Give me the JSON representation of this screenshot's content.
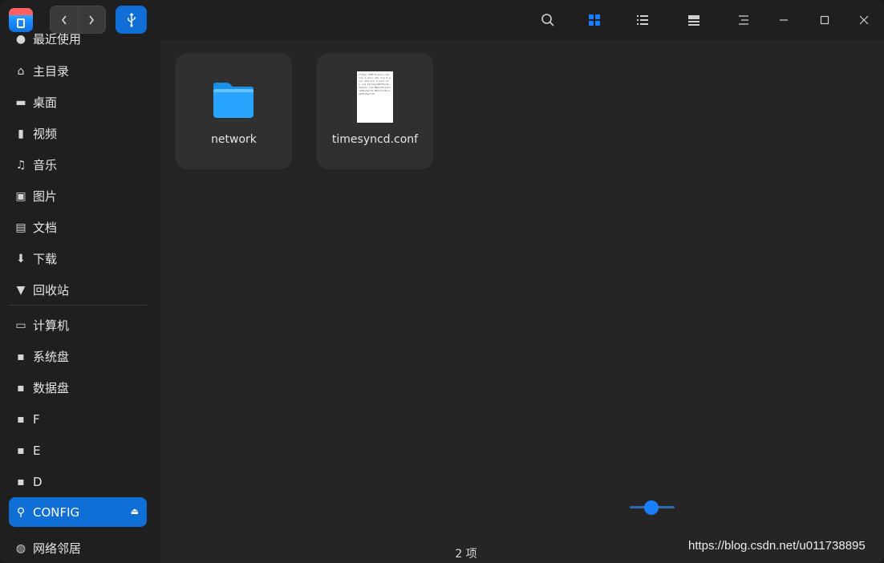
{
  "titlebar": {
    "nav_back_icon": "‹",
    "nav_forward_icon": "›",
    "crumb_icon": "usb-icon"
  },
  "sidebar": {
    "items": [
      {
        "label": "最近使用",
        "icon": "clock-icon"
      },
      {
        "label": "主目录",
        "icon": "home-icon"
      },
      {
        "label": "桌面",
        "icon": "desktop-icon"
      },
      {
        "label": "视频",
        "icon": "video-icon"
      },
      {
        "label": "音乐",
        "icon": "music-icon"
      },
      {
        "label": "图片",
        "icon": "picture-icon"
      },
      {
        "label": "文档",
        "icon": "document-icon"
      },
      {
        "label": "下载",
        "icon": "download-icon"
      },
      {
        "label": "回收站",
        "icon": "trash-icon"
      },
      {
        "label": "计算机",
        "icon": "computer-icon"
      },
      {
        "label": "系统盘",
        "icon": "disk-icon"
      },
      {
        "label": "数据盘",
        "icon": "disk-icon"
      },
      {
        "label": "F",
        "icon": "disk-icon"
      },
      {
        "label": "E",
        "icon": "disk-icon"
      },
      {
        "label": "D",
        "icon": "disk-icon"
      },
      {
        "label": "CONFIG",
        "icon": "usb-icon",
        "selected": true
      },
      {
        "label": "网络邻居",
        "icon": "network-icon"
      }
    ]
  },
  "files": [
    {
      "name": "network",
      "type": "folder"
    },
    {
      "name": "timesyncd.conf",
      "type": "text-file",
      "preview": "[Time] NTP=0.pool.ntp.org 1.pool.ntp.org 2.pool.ntp.org 3.pool.ntp.org FallbackNTP=ntp.ubuntu.com #RootDistanceMaxSec=5 #PollIntervalMinSec=32"
    }
  ],
  "status": {
    "item_count": "2 项"
  },
  "watermark": "https://blog.csdn.net/u011738895",
  "colors": {
    "accent": "#0f6fd6",
    "window_bg": "#252525",
    "sidebar_bg": "#1f1f1f",
    "tile_bg": "#303030"
  }
}
